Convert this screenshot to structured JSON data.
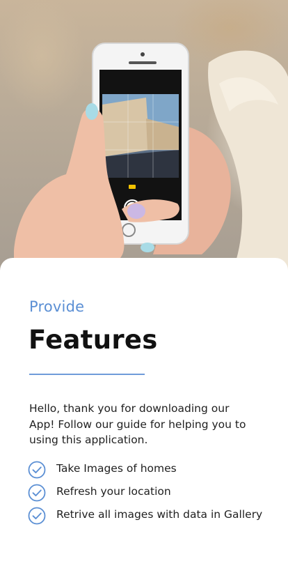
{
  "colors": {
    "accent": "#5b8fd4",
    "divider": "#6f9bd9",
    "title": "#111111",
    "text": "#1f1f1f",
    "background": "#ffffff"
  },
  "hero": {
    "image_subject": "hands holding a smartphone taking a photo of a street building"
  },
  "onboarding": {
    "subtitle": "Provide",
    "title": "Features",
    "description": "Hello, thank you for downloading our App! Follow our guide for helping you to using this application."
  },
  "features": [
    {
      "label": "Take Images of homes",
      "icon": "check-circle-icon"
    },
    {
      "label": "Refresh your location",
      "icon": "check-circle-icon"
    },
    {
      "label": "Retrive all images with data in Gallery",
      "icon": "check-circle-icon"
    }
  ]
}
